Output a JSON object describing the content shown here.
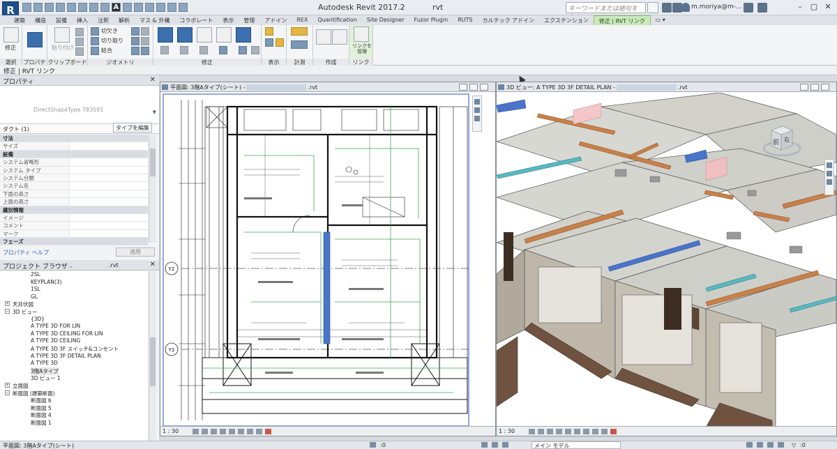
{
  "app": {
    "title": "Autodesk Revit 2017.2",
    "file_suffix": "rvt",
    "logo_letter": "R",
    "qat_a_letter": "A"
  },
  "search": {
    "placeholder": "キーワードまたは語句を入力"
  },
  "user": {
    "name": "m.moriya@m-..."
  },
  "window_controls": {
    "minimize": "–",
    "maximize": "▢",
    "close": "✕"
  },
  "tabs": [
    {
      "label": "建築"
    },
    {
      "label": "構造"
    },
    {
      "label": "設備"
    },
    {
      "label": "挿入"
    },
    {
      "label": "注釈"
    },
    {
      "label": "解析"
    },
    {
      "label": "マス & 外構"
    },
    {
      "label": "コラボレート"
    },
    {
      "label": "表示"
    },
    {
      "label": "管理"
    },
    {
      "label": "アドイン"
    },
    {
      "label": "REX"
    },
    {
      "label": "Quantification"
    },
    {
      "label": "Site Designer"
    },
    {
      "label": "Fuzor Plugin"
    },
    {
      "label": "RUTS"
    },
    {
      "label": "カルテック アドイン"
    },
    {
      "label": "エクステンション"
    },
    {
      "label": "修正 | RVT リンク"
    }
  ],
  "ribbon": {
    "panels": {
      "select": "選択",
      "properties": "プロパティ",
      "clipboard": "クリップボード",
      "geometry": "ジオメトリ",
      "modify": "修正",
      "view": "表示",
      "measure": "計測",
      "create": "作成",
      "link": "リンク"
    },
    "buttons": {
      "modify": "修正",
      "paste": "貼り付け",
      "cope": "切欠き",
      "cut": "切り取り",
      "join": "結合",
      "manage_links": "リンクを管理"
    }
  },
  "options_bar": {
    "label": "修正 | RVT リンク"
  },
  "properties": {
    "title": "プロパティ",
    "close": "✕",
    "type_name": "DirectShapeType 783591",
    "selection_label": "ダクト (1)",
    "edit_type": "タイプを編集",
    "rows": [
      {
        "key": "寸法",
        "group": true
      },
      {
        "key": "サイズ",
        "group": false
      },
      {
        "key": "設備",
        "group": true
      },
      {
        "key": "システム省略形",
        "group": false
      },
      {
        "key": "システム タイプ",
        "group": false
      },
      {
        "key": "システム分類",
        "group": false
      },
      {
        "key": "システム名",
        "group": false
      },
      {
        "key": "下面の高さ",
        "group": false
      },
      {
        "key": "上面の高さ",
        "group": false
      },
      {
        "key": "識別情報",
        "group": true
      },
      {
        "key": "イメージ",
        "group": false
      },
      {
        "key": "コメント",
        "group": false
      },
      {
        "key": "マーク",
        "group": false
      },
      {
        "key": "フェーズ",
        "group": true
      }
    ],
    "help_link": "プロパティ ヘルプ",
    "apply": "適用"
  },
  "browser": {
    "title": "プロジェクト ブラウザ -",
    "file": ".rvt",
    "close": "✕",
    "items": [
      {
        "label": "2SL",
        "level": 2,
        "expander": ""
      },
      {
        "label": "KEYPLAN(3)",
        "level": 2,
        "expander": ""
      },
      {
        "label": "1SL",
        "level": 2,
        "expander": ""
      },
      {
        "label": "GL",
        "level": 2,
        "expander": ""
      },
      {
        "label": "天井伏図",
        "level": 1,
        "expander": "+"
      },
      {
        "label": "3D ビュー",
        "level": 1,
        "expander": "−"
      },
      {
        "label": "{3D}",
        "level": 2,
        "expander": ""
      },
      {
        "label": "A TYPE 3D FOR LIN",
        "level": 2,
        "expander": ""
      },
      {
        "label": "A TYPE 3D CEILING FOR LIN",
        "level": 2,
        "expander": ""
      },
      {
        "label": "A TYPE 3D CEILING",
        "level": 2,
        "expander": ""
      },
      {
        "label": "A TYPE 3D 3F スイッチ&コンセント",
        "level": 2,
        "expander": ""
      },
      {
        "label": "A TYPE 3D 3F DETAIL PLAN",
        "level": 2,
        "expander": ""
      },
      {
        "label": "A TYPE 3D",
        "level": 2,
        "expander": ""
      },
      {
        "label": "3階Aタイプ",
        "level": 2,
        "expander": "",
        "highlight": true
      },
      {
        "label": "3D ビュー 1",
        "level": 2,
        "expander": ""
      },
      {
        "label": "立面図",
        "level": 1,
        "expander": "+"
      },
      {
        "label": "断面図 (建築断面)",
        "level": 1,
        "expander": "−"
      },
      {
        "label": "断面図 6",
        "level": 2,
        "expander": ""
      },
      {
        "label": "断面図 5",
        "level": 2,
        "expander": ""
      },
      {
        "label": "断面図 4",
        "level": 2,
        "expander": ""
      },
      {
        "label": "断面図 1",
        "level": 2,
        "expander": ""
      }
    ]
  },
  "plan_view": {
    "title": "平面図: 3階Aタイプ(シート) -",
    "file": ".rvt",
    "scale": "1 : 30",
    "grid_labels": [
      "Y2",
      "Y1"
    ]
  },
  "view3d": {
    "title": "3D ビュー: A TYPE 3D 3F DETAIL PLAN -",
    "file": ".rvt",
    "scale": "1 : 30",
    "cube_front": "前",
    "cube_right": "右"
  },
  "statusbar": {
    "left": "平面図: 3階Aタイプ(シート)",
    "zero": ":0",
    "model": "メイン モデル",
    "filter": ":0"
  },
  "colors": {
    "ribbon_active_tab": "#cbe9bd",
    "duct_blue": "#4a74c9",
    "duct_orange": "#c8814a",
    "plan_green": "#3da64a",
    "ceiling_grey": "#cfcfc9",
    "floor_brown": "#6f5340"
  }
}
